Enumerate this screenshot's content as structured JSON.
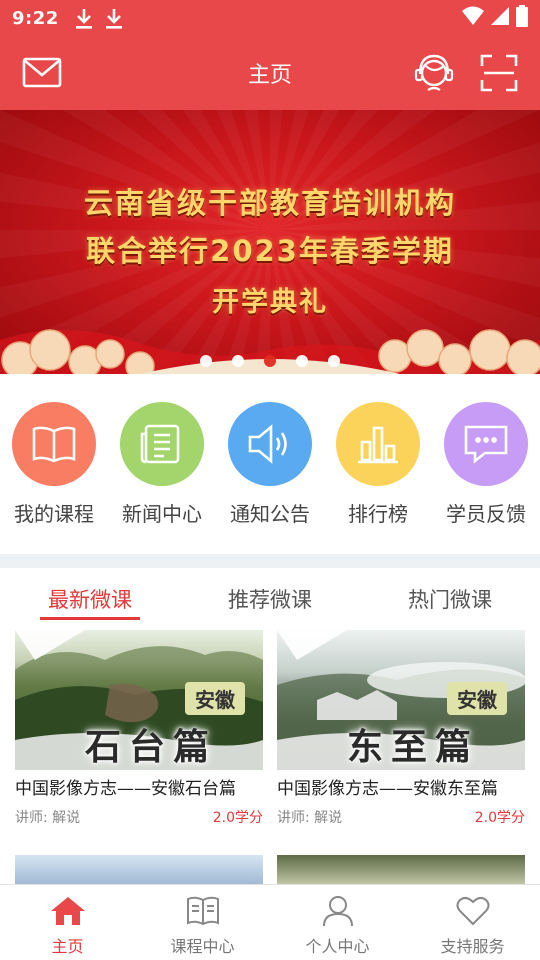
{
  "status_bar": {
    "time": "9:22",
    "icons": [
      "download-icon",
      "download-icon",
      "wifi-icon",
      "signal-icon",
      "battery-icon"
    ]
  },
  "header": {
    "title": "主页",
    "left_icon": "mail-icon",
    "right_icons": [
      "customer-service-icon",
      "scan-icon"
    ]
  },
  "banner": {
    "lines": [
      "云南省级干部教育培训机构",
      "联合举行2023年春季学期",
      "开学典礼"
    ],
    "slide_count": 5,
    "active_slide": 3
  },
  "menu": {
    "items": [
      {
        "label": "我的课程",
        "icon": "book-icon",
        "color": "#f97d62"
      },
      {
        "label": "新闻中心",
        "icon": "news-icon",
        "color": "#a3d56c"
      },
      {
        "label": "通知公告",
        "icon": "speaker-icon",
        "color": "#5aaaf2"
      },
      {
        "label": "排行榜",
        "icon": "bar-chart-icon",
        "color": "#fbd35b"
      },
      {
        "label": "学员反馈",
        "icon": "chat-icon",
        "color": "#c79cf6"
      }
    ]
  },
  "tabs": {
    "items": [
      "最新微课",
      "推荐微课",
      "热门微课"
    ],
    "active": 0
  },
  "courses": [
    {
      "title": "中国影像方志——安徽石台篇",
      "lecturer": "讲师:  解说",
      "credit": "2.0学分",
      "thumb_tag": "安徽",
      "thumb_text": "石台篇"
    },
    {
      "title": "中国影像方志——安徽东至篇",
      "lecturer": "讲师:  解说",
      "credit": "2.0学分",
      "thumb_tag": "安徽",
      "thumb_text": "东至篇"
    }
  ],
  "bottom_nav": {
    "items": [
      {
        "label": "主页",
        "icon": "home-icon"
      },
      {
        "label": "课程中心",
        "icon": "open-book-icon"
      },
      {
        "label": "个人中心",
        "icon": "person-icon"
      },
      {
        "label": "支持服务",
        "icon": "heart-icon"
      }
    ],
    "active": 0
  },
  "colors": {
    "brand": "#e8484a",
    "accent": "#e23a3c"
  }
}
